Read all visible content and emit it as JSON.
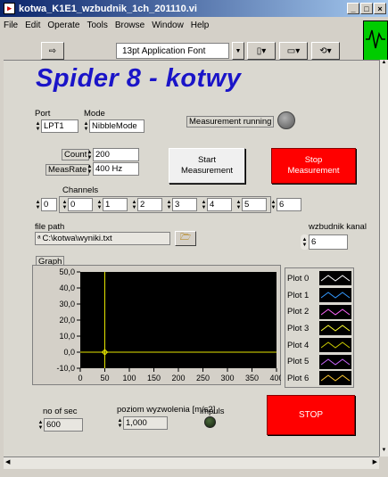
{
  "window": {
    "title": "kotwa_K1E1_wzbudnik_1ch_201110.vi",
    "min": "_",
    "max": "□",
    "close": "×"
  },
  "menu": [
    "File",
    "Edit",
    "Operate",
    "Tools",
    "Browse",
    "Window",
    "Help"
  ],
  "toolbar": {
    "font": "13pt Application Font"
  },
  "panel": {
    "title": "Spider 8 - kotwy",
    "port": {
      "label": "Port",
      "value": "LPT1"
    },
    "mode": {
      "label": "Mode",
      "value": "NibbleMode"
    },
    "measurement_running": {
      "label": "Measurement running"
    },
    "count": {
      "label": "Count",
      "value": "200"
    },
    "measrate": {
      "label": "MeasRate",
      "value": "400 Hz"
    },
    "start_button": {
      "line1": "Start",
      "line2": "Measurement"
    },
    "stop_measure_button": {
      "line1": "Stop",
      "line2": "Measurement"
    },
    "channels": {
      "label": "Channels",
      "index": "0",
      "values": [
        "0",
        "1",
        "2",
        "3",
        "4",
        "5",
        "6"
      ]
    },
    "file_path": {
      "label": "file path",
      "value": "C:\\kotwa\\wyniki.txt"
    },
    "wzbudnik": {
      "label": "wzbudnik kanal",
      "value": "6"
    },
    "graph": {
      "label": "Graph"
    },
    "no_of_sec": {
      "label": "no of sec",
      "value": "600"
    },
    "poziom": {
      "label": "poziom wyzwolenia [m/s2]",
      "value": "1,000"
    },
    "impuls": {
      "label": "impuls"
    },
    "stop_button": {
      "label": "STOP"
    }
  },
  "chart_data": {
    "type": "line",
    "title": "",
    "xlabel": "",
    "ylabel": "",
    "xlim": [
      0,
      400
    ],
    "ylim": [
      -10,
      50
    ],
    "x_ticks": [
      "0",
      "50",
      "100",
      "150",
      "200",
      "250",
      "300",
      "350",
      "400"
    ],
    "y_ticks": [
      "50,0",
      "40,0",
      "30,0",
      "20,0",
      "10,0",
      "0,0",
      "-10,0"
    ],
    "cursor": {
      "x": 50,
      "y": 0
    },
    "series": [
      {
        "name": "Plot 0",
        "color": "#ffffff",
        "values": []
      },
      {
        "name": "Plot 1",
        "color": "#3399ff",
        "values": []
      },
      {
        "name": "Plot 2",
        "color": "#ff66ff",
        "values": []
      },
      {
        "name": "Plot 3",
        "color": "#ffff33",
        "values": []
      },
      {
        "name": "Plot 4",
        "color": "#cccc00",
        "values": []
      },
      {
        "name": "Plot 5",
        "color": "#cc66ff",
        "values": []
      },
      {
        "name": "Plot 6",
        "color": "#ffcc33",
        "values": []
      }
    ]
  }
}
